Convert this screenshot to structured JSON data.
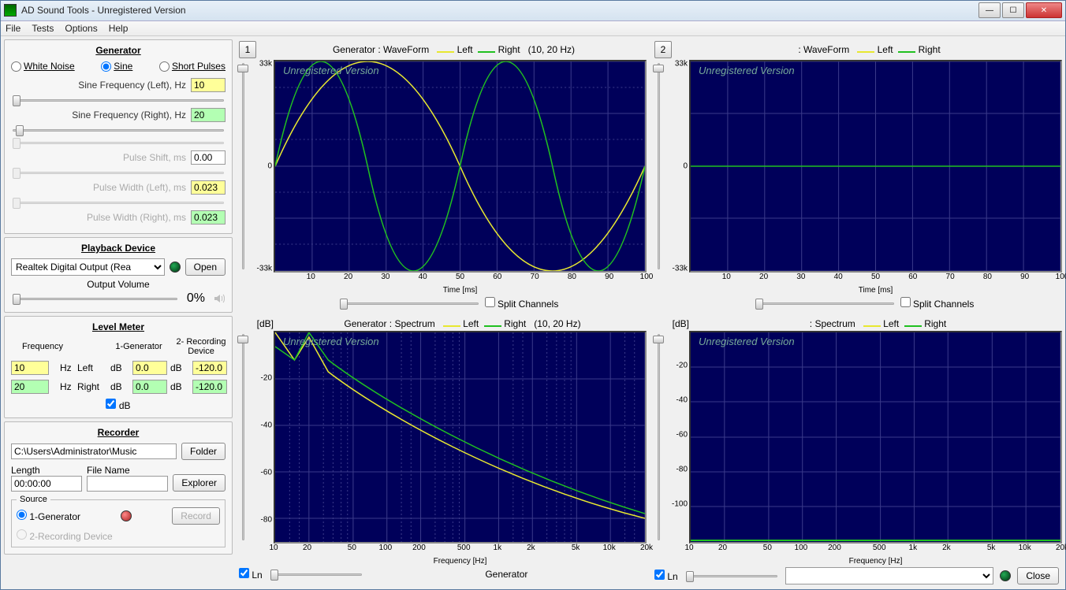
{
  "window": {
    "title": "AD Sound Tools - Unregistered Version"
  },
  "menu": {
    "file": "File",
    "tests": "Tests",
    "options": "Options",
    "help": "Help"
  },
  "generator": {
    "title": "Generator",
    "white_noise": "White Noise",
    "sine": "Sine",
    "short_pulses": "Short Pulses",
    "sine_freq_left_lbl": "Sine Frequency  (Left),  Hz",
    "sine_freq_left_val": "10",
    "sine_freq_right_lbl": "Sine Frequency (Right), Hz",
    "sine_freq_right_val": "20",
    "pulse_shift_lbl": "Pulse Shift, ms",
    "pulse_shift_val": "0.00",
    "pulse_width_left_lbl": "Pulse Width  (Left), ms",
    "pulse_width_left_val": "0.023",
    "pulse_width_right_lbl": "Pulse Width (Right), ms",
    "pulse_width_right_val": "0.023"
  },
  "playback": {
    "title": "Playback Device",
    "device": "Realtek Digital Output (Rea",
    "open": "Open",
    "output_volume_lbl": "Output Volume",
    "output_volume_val": "0%"
  },
  "level": {
    "title": "Level Meter",
    "freq_hd": "Frequency",
    "gen_hd": "1-Generator",
    "rec_hd": "2- Recording Device",
    "hz": "Hz",
    "left": "Left",
    "right": "Right",
    "db": "dB",
    "freq_left": "10",
    "freq_right": "20",
    "gen_left": "0.0",
    "gen_right": "0.0",
    "rec_left": "-120.0",
    "rec_right": "-120.0",
    "db_check": "dB"
  },
  "recorder": {
    "title": "Recorder",
    "path": "C:\\Users\\Administrator\\Music",
    "folder": "Folder",
    "length_lbl": "Length",
    "length_val": "00:00:00",
    "filename_lbl": "File Name",
    "explorer": "Explorer",
    "source": "Source",
    "src1": "1-Generator",
    "src2": "2-Recording Device",
    "record": "Record"
  },
  "charts": {
    "watermark": "Unregistered Version",
    "split": "Split Channels",
    "ln": "Ln",
    "generator_lbl": "Generator",
    "close": "Close",
    "c1": {
      "num": "1",
      "title": "Generator : WaveForm",
      "left": "Left",
      "right": "Right",
      "info": "(10, 20 Hz)",
      "xlabel": "Time [ms]",
      "yticks": [
        "33k",
        "0",
        "-33k"
      ],
      "xticks": [
        "10",
        "20",
        "30",
        "40",
        "50",
        "60",
        "70",
        "80",
        "90",
        "100"
      ]
    },
    "c2": {
      "num": "2",
      "title": ": WaveForm",
      "left": "Left",
      "right": "Right",
      "info": "",
      "xlabel": "Time [ms]",
      "yticks": [
        "33k",
        "0",
        "-33k"
      ],
      "xticks": [
        "10",
        "20",
        "30",
        "40",
        "50",
        "60",
        "70",
        "80",
        "90",
        "100"
      ]
    },
    "c3": {
      "title": "Generator : Spectrum",
      "left": "Left",
      "right": "Right",
      "info": "(10, 20 Hz)",
      "xlabel": "Frequency [Hz]",
      "ylabel": "[dB]",
      "yticks": [
        "-20",
        "-40",
        "-60",
        "-80"
      ],
      "xticks": [
        "10",
        "20",
        "50",
        "100",
        "200",
        "500",
        "1k",
        "2k",
        "5k",
        "10k",
        "20k"
      ]
    },
    "c4": {
      "title": ": Spectrum",
      "left": "Left",
      "right": "Right",
      "info": "",
      "xlabel": "Frequency [Hz]",
      "ylabel": "[dB]",
      "yticks": [
        "-20",
        "-40",
        "-60",
        "-80",
        "-100"
      ],
      "xticks": [
        "10",
        "20",
        "50",
        "100",
        "200",
        "500",
        "1k",
        "2k",
        "5k",
        "10k",
        "20k"
      ]
    }
  },
  "chart_data": [
    {
      "type": "line",
      "title": "Generator : WaveForm",
      "xlabel": "Time [ms]",
      "ylabel": "",
      "xlim": [
        0,
        100
      ],
      "ylim": [
        -33000,
        33000
      ],
      "series": [
        {
          "name": "Left",
          "color": "#e8e830",
          "x": [
            0,
            10,
            20,
            30,
            40,
            50,
            60,
            70,
            80,
            90,
            100
          ],
          "y": [
            0,
            19400,
            31400,
            31400,
            19400,
            0,
            -19400,
            -31400,
            -31400,
            -19400,
            0
          ]
        },
        {
          "name": "Right",
          "color": "#20c020",
          "x": [
            0,
            5,
            10,
            15,
            20,
            25,
            30,
            35,
            40,
            45,
            50,
            55,
            60,
            65,
            70,
            75,
            80,
            85,
            90,
            95,
            100
          ],
          "y": [
            0,
            19400,
            31400,
            31400,
            19400,
            0,
            -19400,
            -31400,
            -31400,
            -19400,
            0,
            19400,
            31400,
            31400,
            19400,
            0,
            -19400,
            -31400,
            -31400,
            -19400,
            0
          ]
        }
      ]
    },
    {
      "type": "line",
      "title": ": WaveForm",
      "xlabel": "Time [ms]",
      "ylabel": "",
      "xlim": [
        0,
        100
      ],
      "ylim": [
        -33000,
        33000
      ],
      "series": [
        {
          "name": "Left",
          "color": "#e8e830",
          "x": [
            0,
            100
          ],
          "y": [
            0,
            0
          ]
        },
        {
          "name": "Right",
          "color": "#20c020",
          "x": [
            0,
            100
          ],
          "y": [
            0,
            0
          ]
        }
      ]
    },
    {
      "type": "line",
      "title": "Generator : Spectrum",
      "xlabel": "Frequency [Hz]",
      "ylabel": "[dB]",
      "xlim": [
        10,
        20000
      ],
      "ylim": [
        -90,
        0
      ],
      "series": [
        {
          "name": "Left",
          "color": "#e8e830",
          "x": [
            10,
            15,
            20,
            30,
            50,
            100,
            200,
            500,
            1000,
            2000,
            5000,
            10000,
            20000
          ],
          "y": [
            0,
            -12,
            -2,
            -18,
            -28,
            -38,
            -48,
            -58,
            -65,
            -71,
            -77,
            -80,
            -80
          ]
        },
        {
          "name": "Right",
          "color": "#20c020",
          "x": [
            10,
            15,
            20,
            30,
            50,
            100,
            200,
            500,
            1000,
            2000,
            5000,
            10000,
            20000
          ],
          "y": [
            -6,
            -12,
            0,
            -12,
            -22,
            -32,
            -42,
            -52,
            -60,
            -66,
            -72,
            -76,
            -78
          ]
        }
      ]
    },
    {
      "type": "line",
      "title": ": Spectrum",
      "xlabel": "Frequency [Hz]",
      "ylabel": "[dB]",
      "xlim": [
        10,
        20000
      ],
      "ylim": [
        -120,
        0
      ],
      "series": [
        {
          "name": "Left",
          "color": "#e8e830",
          "x": [
            10,
            20000
          ],
          "y": [
            -120,
            -120
          ]
        },
        {
          "name": "Right",
          "color": "#20c020",
          "x": [
            10,
            20000
          ],
          "y": [
            -120,
            -120
          ]
        }
      ]
    }
  ]
}
